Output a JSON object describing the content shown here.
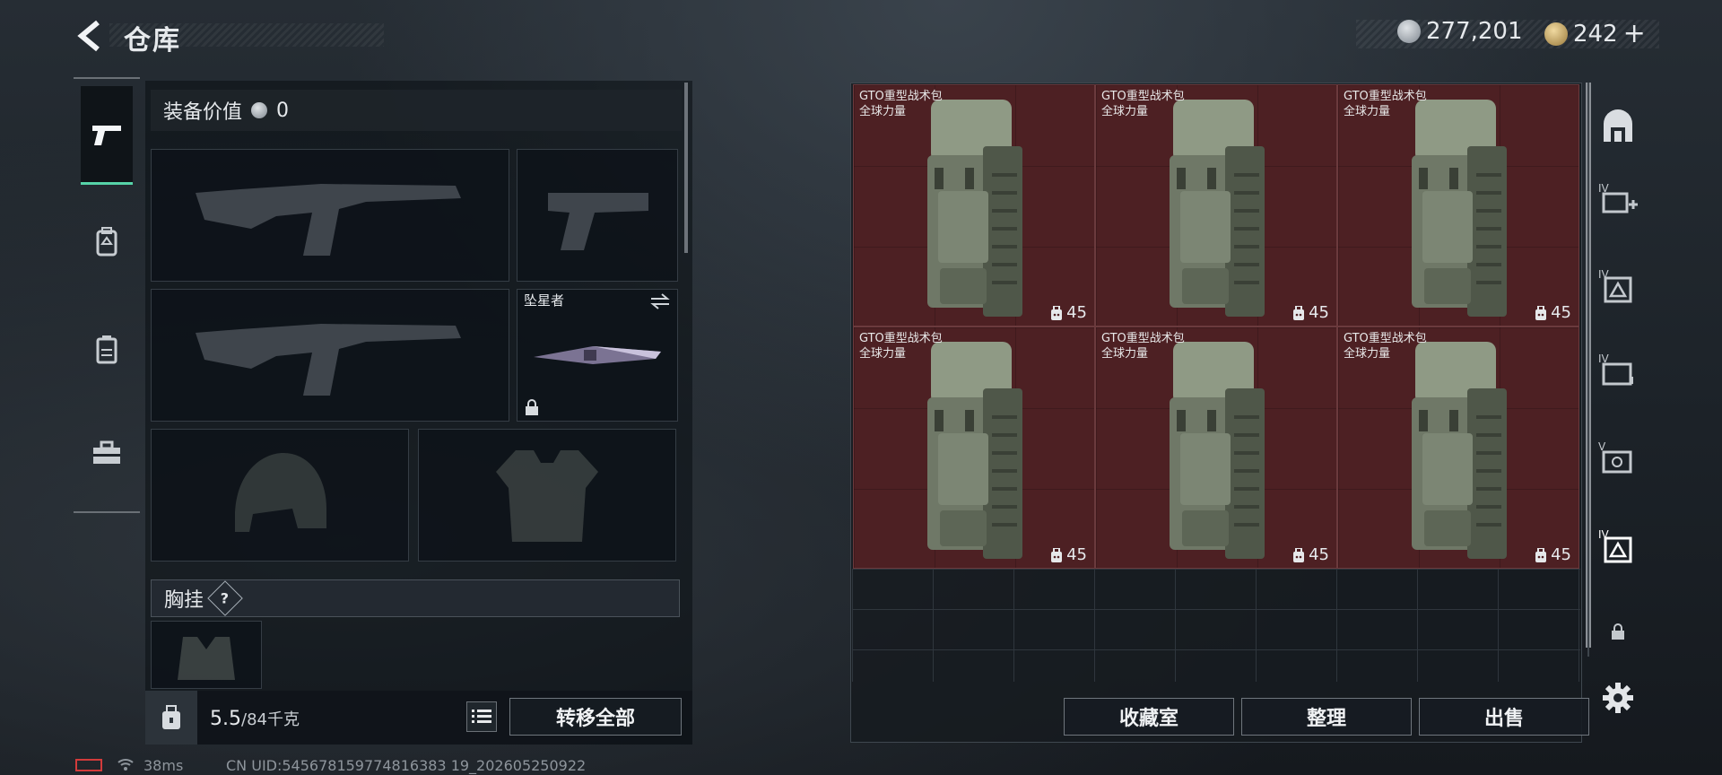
{
  "header": {
    "title": "仓库",
    "currency_silver": "277,201",
    "currency_gold": "242",
    "currency_plus": "+"
  },
  "rail": {
    "items": [
      {
        "icon": "pistol-icon",
        "active": true
      },
      {
        "icon": "backpack-icon",
        "active": false
      },
      {
        "icon": "vest-icon",
        "active": false
      },
      {
        "icon": "toolbox-icon",
        "active": false
      }
    ]
  },
  "equipment": {
    "value_label": "装备价值",
    "value": "0",
    "melee_name": "坠星者",
    "chest_label": "胸挂",
    "chest_help": "?"
  },
  "capacity": {
    "current": "5.5",
    "max": "/84千克"
  },
  "buttons": {
    "transfer_all": "转移全部",
    "collection": "收藏室",
    "organize": "整理",
    "sell": "出售"
  },
  "storage": {
    "items": [
      {
        "name": "GTO重型战术包",
        "subtitle": "全球力量",
        "count": "45"
      },
      {
        "name": "GTO重型战术包",
        "subtitle": "全球力量",
        "count": "45"
      },
      {
        "name": "GTO重型战术包",
        "subtitle": "全球力量",
        "count": "45"
      },
      {
        "name": "GTO重型战术包",
        "subtitle": "全球力量",
        "count": "45"
      },
      {
        "name": "GTO重型战术包",
        "subtitle": "全球力量",
        "count": "45"
      },
      {
        "name": "GTO重型战术包",
        "subtitle": "全球力量",
        "count": "45"
      }
    ]
  },
  "side_tabs": [
    "storage-home-icon",
    "ammo-storage-icon",
    "gear-storage-icon",
    "document-storage-icon",
    "medical-storage-icon",
    "backpack-storage-icon",
    "lock-icon"
  ],
  "status": {
    "ping": "38ms",
    "uid": "CN UID:545678159774816383 19_202605250922"
  }
}
